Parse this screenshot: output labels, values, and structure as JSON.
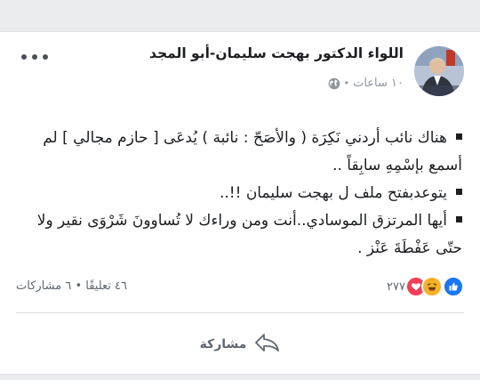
{
  "post": {
    "author": "اللواء الدكتور بهجت سليمان-أبو المجد",
    "time": "١٠ ساعات",
    "meta_separator": "•",
    "paragraphs": [
      "هناك نائب أردني نَكِرَة ( والأصَحّ : نائبة ) يُدعَى [ حازم مجالي ] لم أسمع بإسْمِهِ سابِقاً ..",
      "يتوعدبفتح ملف ل بهجت سليمان !!..",
      "أيها المرتزق الموسادي..أنت ومن وراءك لا تُساوونَ شَرْوَى  نقير ولا حتّى عَفْطَةَ عَنْز ."
    ]
  },
  "reactions": {
    "types": [
      "like-icon",
      "haha-icon",
      "love-icon"
    ],
    "count": "٢٧٧",
    "colors": {
      "like": "#1877f2",
      "haha": "#f7b125",
      "love": "#f33e58"
    }
  },
  "engagement": {
    "summary": "٤٦ تعليقًا • ٦ مشاركات"
  },
  "actions": {
    "share_label": "مشاركة"
  }
}
